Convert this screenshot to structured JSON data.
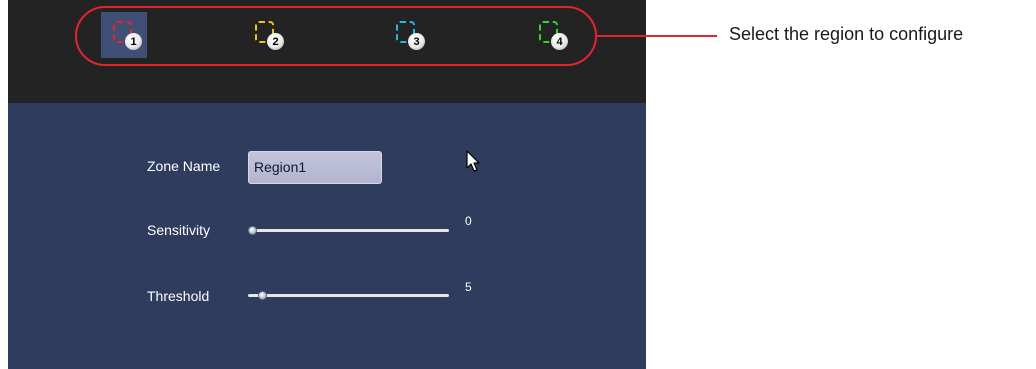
{
  "regions": [
    {
      "number": "1",
      "color": "#e8232b",
      "selected": true
    },
    {
      "number": "2",
      "color": "#f5c01f",
      "selected": false
    },
    {
      "number": "3",
      "color": "#24b8e6",
      "selected": false
    },
    {
      "number": "4",
      "color": "#33d42e",
      "selected": false
    }
  ],
  "callout": {
    "text": "Select the region to configure",
    "color": "#e0252c"
  },
  "form": {
    "zone_name_label": "Zone Name",
    "zone_name_value": "Region1",
    "sensitivity_label": "Sensitivity",
    "sensitivity_value": "0",
    "sensitivity_fraction": 0.0,
    "threshold_label": "Threshold",
    "threshold_value": "5",
    "threshold_fraction": 0.05
  },
  "icons": {
    "cursor": "mouse-pointer-icon"
  }
}
